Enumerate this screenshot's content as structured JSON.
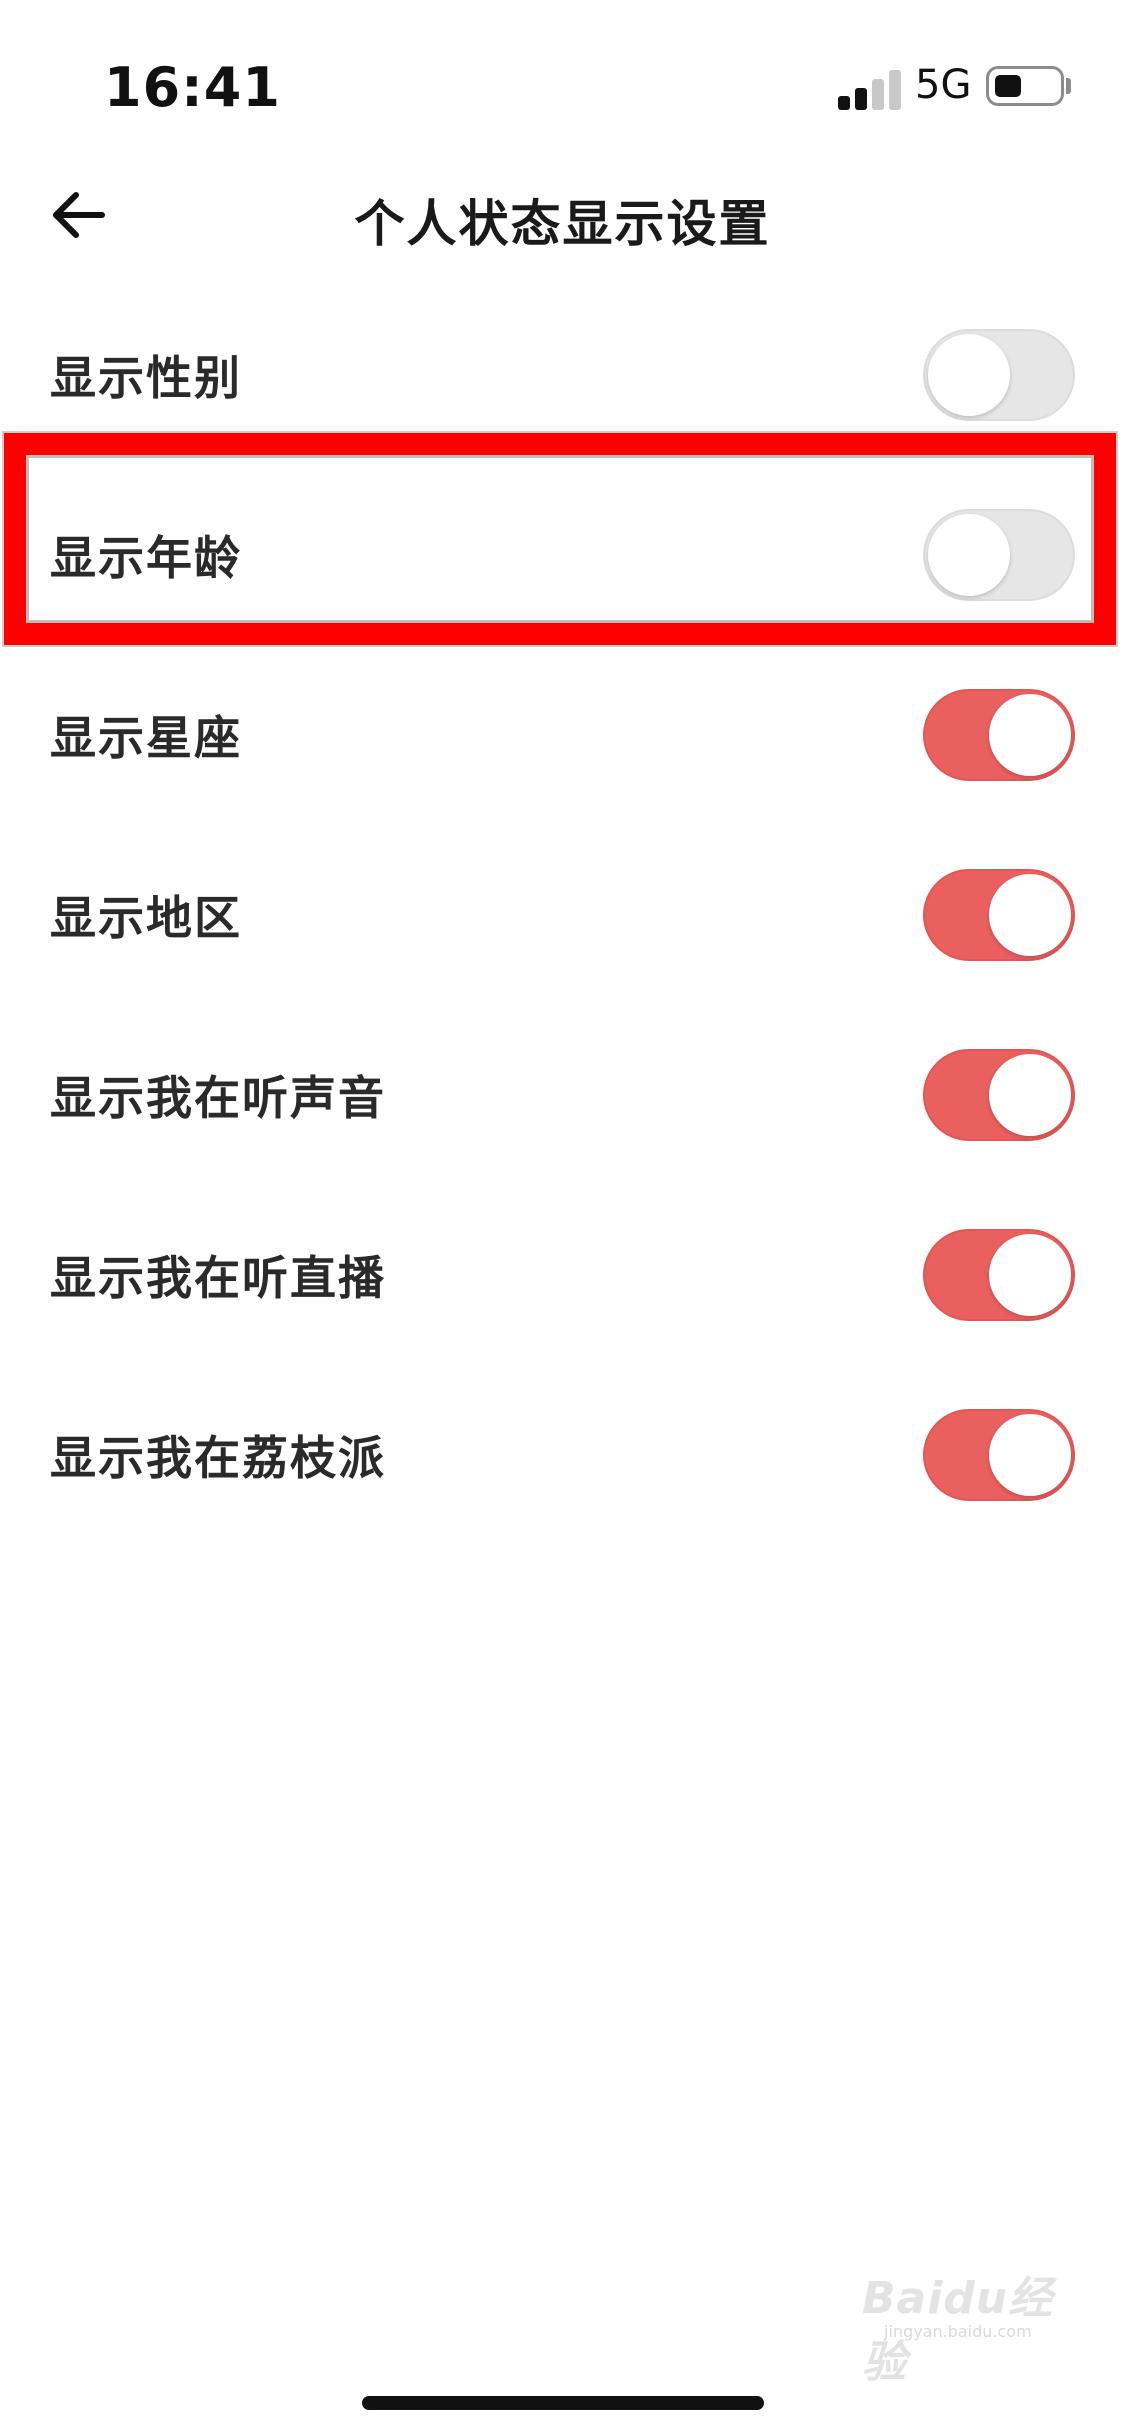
{
  "status_bar": {
    "time": "16:41",
    "network": "5G",
    "signal_bars_active": 2,
    "signal_bars_total": 4,
    "battery_level": 0.4
  },
  "nav": {
    "back_icon": "arrow-left-icon",
    "title": "个人状态显示设置"
  },
  "settings": [
    {
      "label": "显示性别",
      "enabled": false
    },
    {
      "label": "显示年龄",
      "enabled": false
    },
    {
      "label": "显示星座",
      "enabled": true
    },
    {
      "label": "显示地区",
      "enabled": true
    },
    {
      "label": "显示我在听声音",
      "enabled": true
    },
    {
      "label": "显示我在听直播",
      "enabled": true
    },
    {
      "label": "显示我在荔枝派",
      "enabled": true
    }
  ],
  "highlight": {
    "target": "显示年龄",
    "color": "#ff0000"
  },
  "colors": {
    "toggle_on": "#e9605f",
    "toggle_off": "#e6e6e6",
    "background": "#ffffff"
  },
  "watermark": {
    "logo": "Baidu经验",
    "url": "jingyan.baidu.com"
  }
}
